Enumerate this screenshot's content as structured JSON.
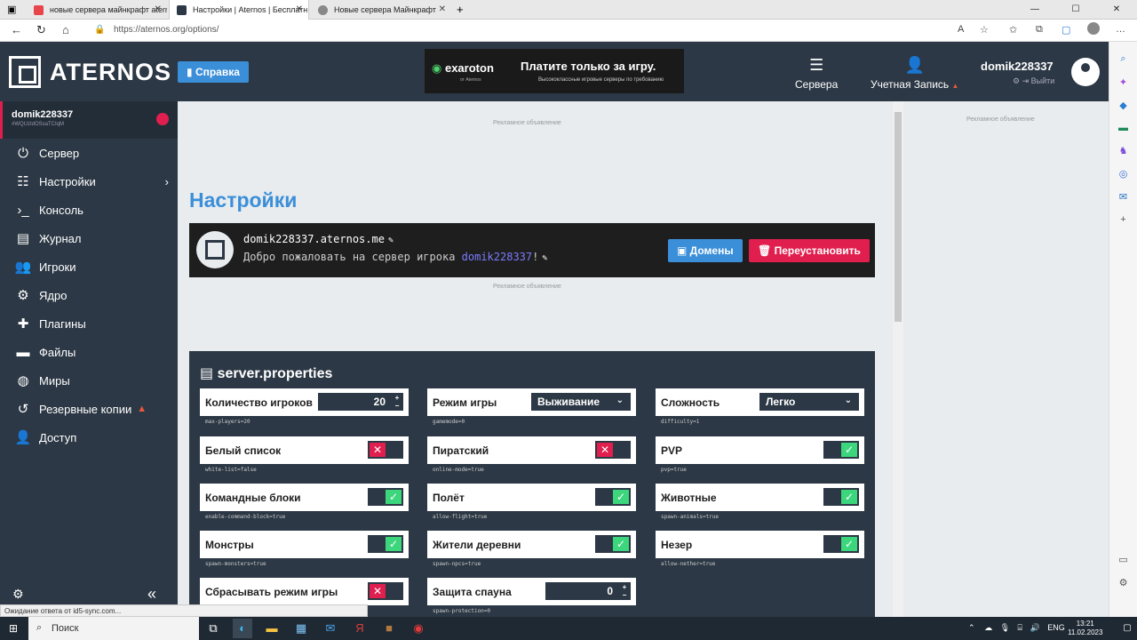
{
  "browser": {
    "tabs": [
      {
        "label": "новые сервера майнкрафт aterno",
        "active": false
      },
      {
        "label": "Настройки | Aternos | Бесплатн",
        "active": true
      },
      {
        "label": "Новые сервера Майнкрафт",
        "active": false
      }
    ],
    "new_tab": "+",
    "url": "https://aternos.org/options/"
  },
  "header": {
    "logo_text": "ATERNOS",
    "help_label": "Справка",
    "ad": {
      "brand_prefix": "exa",
      "brand": "roton",
      "brand_sub": "от Aternos",
      "slogan": "Платите только за игру.",
      "slogan_sub": "Высококлассные игровые серверы по требованию"
    },
    "nav_servers": "Сервера",
    "nav_account": "Учетная Запись",
    "account_warn": "▲",
    "username": "domik228337",
    "logout": "Выйти"
  },
  "sidebar": {
    "server_name": "domik228337",
    "server_id": "#WQUzIdOSsaTCIqM",
    "items": [
      {
        "label": "Сервер",
        "icon": "power-icon"
      },
      {
        "label": "Настройки",
        "icon": "sliders-icon",
        "arrow": "›"
      },
      {
        "label": "Консоль",
        "icon": "terminal-icon"
      },
      {
        "label": "Журнал",
        "icon": "file-icon"
      },
      {
        "label": "Игроки",
        "icon": "users-icon"
      },
      {
        "label": "Ядро",
        "icon": "cogs-icon"
      },
      {
        "label": "Плагины",
        "icon": "puzzle-icon"
      },
      {
        "label": "Файлы",
        "icon": "folder-icon"
      },
      {
        "label": "Миры",
        "icon": "globe-icon"
      },
      {
        "label": "Резервные копии",
        "icon": "history-icon",
        "warn": "▲"
      },
      {
        "label": "Доступ",
        "icon": "user-lock-icon"
      }
    ],
    "collapse": "«"
  },
  "status_message": "Ожидание ответа от id5-sync.com...",
  "main": {
    "ad_label": "Рекламное объявление",
    "title": "Настройки",
    "server": {
      "address": "domik228337.aternos.me",
      "motd_prefix": "Добро пожаловать на сервер игрока ",
      "motd_player": "domik228337",
      "motd_suffix": "!"
    },
    "domains_button": "Домены",
    "reinstall_button": "Переустановить"
  },
  "right_ad_label": "Рекламное объявление",
  "properties": {
    "title": "server.properties",
    "options": [
      {
        "label": "Количество игроков",
        "key": "max-players=20",
        "type": "number",
        "value": "20"
      },
      {
        "label": "Режим игры",
        "key": "gamemode=0",
        "type": "select",
        "value": "Выживание"
      },
      {
        "label": "Сложность",
        "key": "difficulty=1",
        "type": "select",
        "value": "Легко"
      },
      {
        "label": "Белый список",
        "key": "white-list=false",
        "type": "toggle",
        "value": false
      },
      {
        "label": "Пиратский",
        "key": "online-mode=true",
        "type": "toggle",
        "value": false
      },
      {
        "label": "PVP",
        "key": "pvp=true",
        "type": "toggle",
        "value": true
      },
      {
        "label": "Командные блоки",
        "key": "enable-command-block=true",
        "type": "toggle",
        "value": true
      },
      {
        "label": "Полёт",
        "key": "allow-flight=true",
        "type": "toggle",
        "value": true
      },
      {
        "label": "Животные",
        "key": "spawn-animals=true",
        "type": "toggle",
        "value": true
      },
      {
        "label": "Монстры",
        "key": "spawn-monsters=true",
        "type": "toggle",
        "value": true
      },
      {
        "label": "Жители деревни",
        "key": "spawn-npcs=true",
        "type": "toggle",
        "value": true
      },
      {
        "label": "Незер",
        "key": "allow-nether=true",
        "type": "toggle",
        "value": true
      },
      {
        "label": "Сбрасывать режим игры",
        "key": "",
        "type": "toggle",
        "value": false
      },
      {
        "label": "Защита спауна",
        "key": "spawn-protection=0",
        "type": "number",
        "value": "0"
      }
    ]
  },
  "taskbar": {
    "search": "Поиск",
    "lang": "ENG",
    "time": "13:21",
    "date": "11.02.2023"
  },
  "colors": {
    "accent": "#3b8fd9",
    "danger": "#e01f4f",
    "success": "#3cd67c",
    "panel": "#2c3845"
  }
}
